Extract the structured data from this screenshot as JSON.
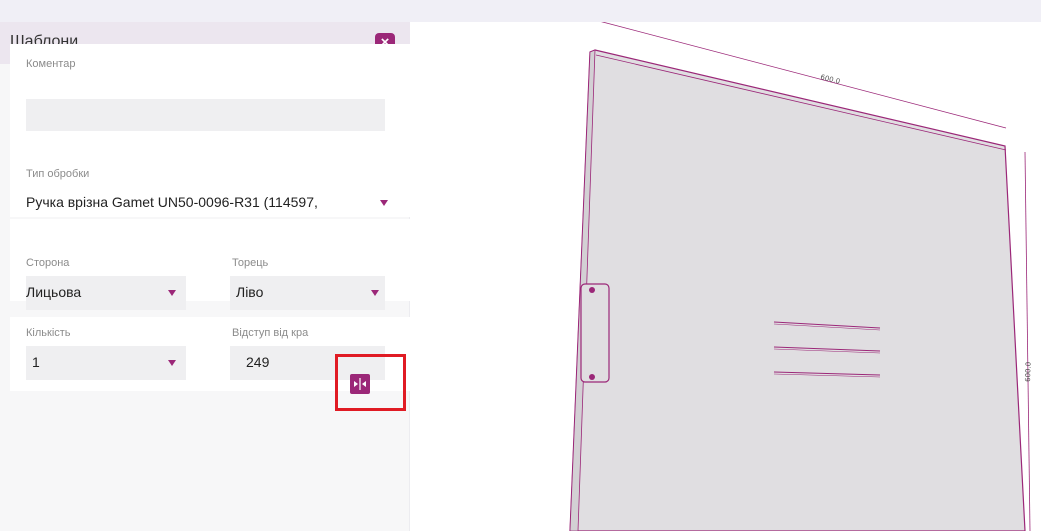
{
  "panel": {
    "title": "Шаблони",
    "close_symbol": "×",
    "comment": {
      "label": "Коментар",
      "value": ""
    },
    "processing_type": {
      "label": "Тип обробки",
      "value": "Ручка врізна Gamet UN50-0096-R31 (114597,"
    },
    "side": {
      "label": "Сторона",
      "value": "Лицьова"
    },
    "edge": {
      "label": "Торець",
      "value": "Ліво"
    },
    "quantity": {
      "label": "Кількість",
      "value": "1"
    },
    "offset": {
      "label": "Відступ від кра",
      "value": "249"
    }
  },
  "drawing": {
    "dimension_width": "600.0",
    "dimension_height": "600.0"
  },
  "colors": {
    "accent": "#9b2778",
    "highlight": "#e01b24",
    "panel_fill": "#e0dee1"
  },
  "icons": {
    "close": "close-icon",
    "center": "center-align-icon",
    "dropdown": "triangle-down-icon"
  }
}
